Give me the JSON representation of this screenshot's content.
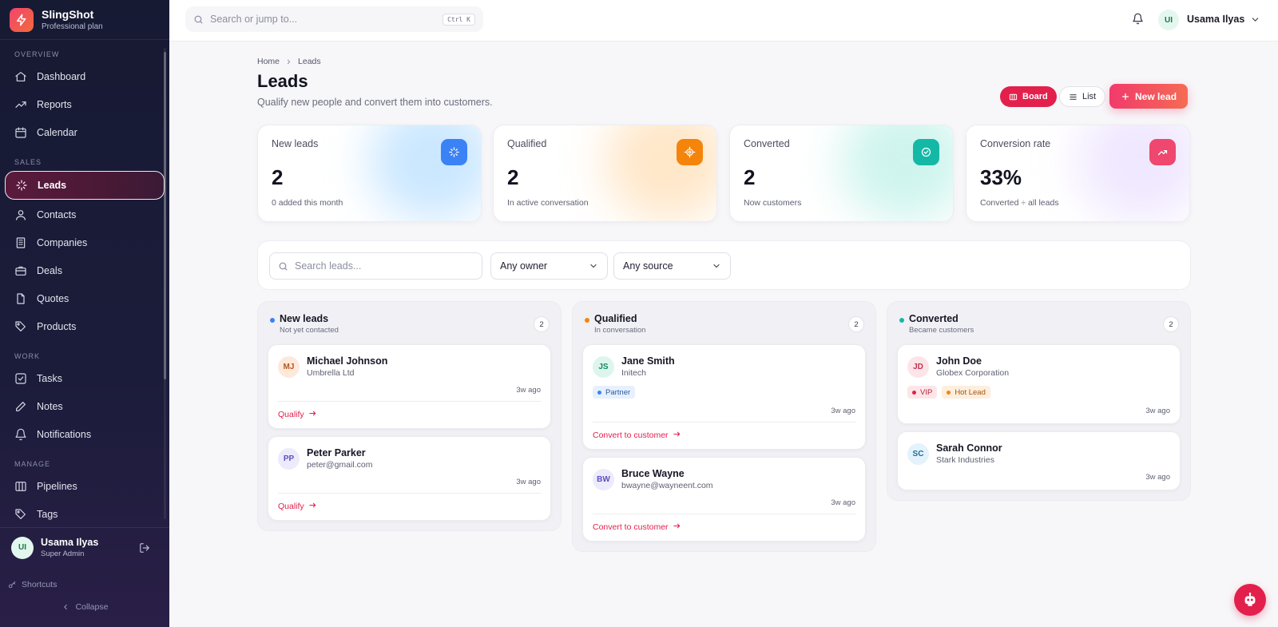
{
  "brand": {
    "name": "SlingShot",
    "plan": "Professional plan"
  },
  "sidebar": {
    "sections": [
      {
        "title": "OVERVIEW",
        "items": [
          {
            "label": "Dashboard",
            "icon": "home-icon"
          },
          {
            "label": "Reports",
            "icon": "trend-icon"
          },
          {
            "label": "Calendar",
            "icon": "calendar-icon"
          }
        ]
      },
      {
        "title": "SALES",
        "items": [
          {
            "label": "Leads",
            "icon": "sparkle-icon",
            "active": true
          },
          {
            "label": "Contacts",
            "icon": "contacts-icon"
          },
          {
            "label": "Companies",
            "icon": "building-icon"
          },
          {
            "label": "Deals",
            "icon": "briefcase-icon"
          },
          {
            "label": "Quotes",
            "icon": "file-icon"
          },
          {
            "label": "Products",
            "icon": "tag-icon"
          }
        ]
      },
      {
        "title": "WORK",
        "items": [
          {
            "label": "Tasks",
            "icon": "check-square-icon"
          },
          {
            "label": "Notes",
            "icon": "edit-icon"
          },
          {
            "label": "Notifications",
            "icon": "bell-icon"
          }
        ]
      },
      {
        "title": "MANAGE",
        "items": [
          {
            "label": "Pipelines",
            "icon": "columns-icon"
          },
          {
            "label": "Tags",
            "icon": "tag-icon"
          }
        ]
      }
    ],
    "user": {
      "initials": "UI",
      "name": "Usama Ilyas",
      "role": "Super Admin"
    },
    "shortcuts": "Shortcuts",
    "collapse": "Collapse"
  },
  "topbar": {
    "search_placeholder": "Search or jump to...",
    "shortcut": "Ctrl K",
    "user_initials": "UI",
    "user_name": "Usama Ilyas"
  },
  "breadcrumb": [
    "Home",
    "Leads"
  ],
  "page": {
    "title": "Leads",
    "subtitle": "Qualify new people and convert them into customers."
  },
  "view_buttons": {
    "board": "Board",
    "list": "List",
    "new_lead": "New lead"
  },
  "stats": [
    {
      "label": "New leads",
      "value": "2",
      "note": "0 added this month",
      "icon": "sparkle-icon",
      "color": "#3b82f6",
      "glow": "#9fd4ff"
    },
    {
      "label": "Qualified",
      "value": "2",
      "note": "In active conversation",
      "icon": "target-icon",
      "color": "#f5840b",
      "glow": "#ffd39c"
    },
    {
      "label": "Converted",
      "value": "2",
      "note": "Now customers",
      "icon": "check-circle-icon",
      "color": "#14b8a6",
      "glow": "#a6ecdf"
    },
    {
      "label": "Conversion rate",
      "value": "33%",
      "note": "Converted ÷ all leads",
      "icon": "trend-up-icon",
      "color": "#ef476f",
      "glow": "#e3d4ff"
    }
  ],
  "filters": {
    "search_placeholder": "Search leads...",
    "owner": "Any owner",
    "source": "Any source"
  },
  "columns": [
    {
      "title": "New leads",
      "subtitle": "Not yet contacted",
      "count": "2",
      "dot": "#3b82f6",
      "action": "Qualify",
      "cards": [
        {
          "initials": "MJ",
          "name": "Michael Johnson",
          "org": "Umbrella Ltd",
          "time": "3w ago",
          "avatar_bg": "#fde9dc",
          "avatar_fg": "#b8561f",
          "tags": []
        },
        {
          "initials": "PP",
          "name": "Peter Parker",
          "org": "peter@gmail.com",
          "time": "3w ago",
          "avatar_bg": "#ecebfb",
          "avatar_fg": "#5b4fc4",
          "tags": []
        }
      ]
    },
    {
      "title": "Qualified",
      "subtitle": "In conversation",
      "count": "2",
      "dot": "#f5840b",
      "action": "Convert to customer",
      "cards": [
        {
          "initials": "JS",
          "name": "Jane Smith",
          "org": "Initech",
          "time": "3w ago",
          "avatar_bg": "#dcf6ee",
          "avatar_fg": "#178563",
          "tags": [
            {
              "label": "Partner",
              "bg": "#e7f0fd",
              "fg": "#2c5aa0",
              "dot": "#3b82f6"
            }
          ]
        },
        {
          "initials": "BW",
          "name": "Bruce Wayne",
          "org": "bwayne@wayneent.com",
          "time": "3w ago",
          "avatar_bg": "#ecebfb",
          "avatar_fg": "#5b4fc4",
          "tags": []
        }
      ]
    },
    {
      "title": "Converted",
      "subtitle": "Became customers",
      "count": "2",
      "dot": "#14b8a6",
      "action": "",
      "cards": [
        {
          "initials": "JD",
          "name": "John Doe",
          "org": "Globex Corporation",
          "time": "3w ago",
          "avatar_bg": "#fde4e8",
          "avatar_fg": "#c2334f",
          "tags": [
            {
              "label": "VIP",
              "bg": "#fde6e8",
              "fg": "#b4243d",
              "dot": "#e3204c"
            },
            {
              "label": "Hot Lead",
              "bg": "#fdeedd",
              "fg": "#a45510",
              "dot": "#f5840b"
            }
          ]
        },
        {
          "initials": "SC",
          "name": "Sarah Connor",
          "org": "Stark Industries",
          "time": "3w ago",
          "avatar_bg": "#e3f2fb",
          "avatar_fg": "#1f6e96",
          "tags": []
        }
      ]
    }
  ]
}
